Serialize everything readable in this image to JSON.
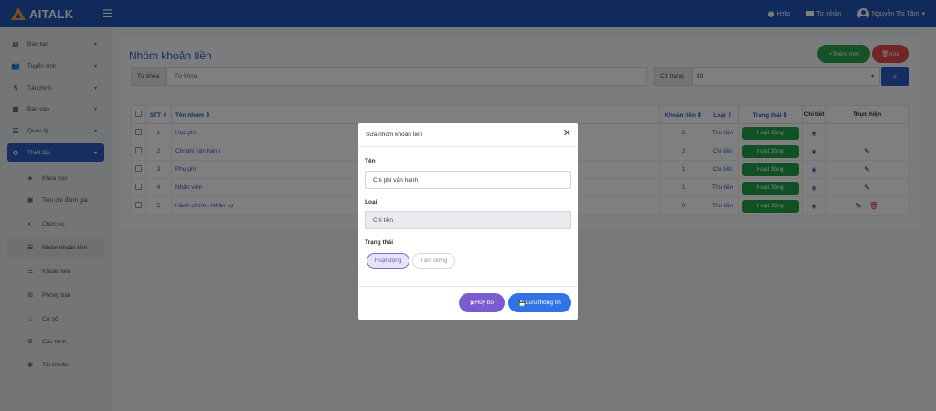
{
  "app": {
    "logo_text": "AITALK"
  },
  "topbar": {
    "help_label": "Help",
    "messages_label": "Tin nhắn",
    "user_name": "Nguyễn Thị Tâm"
  },
  "sidebar": {
    "items": [
      {
        "label": "Đào tạo",
        "icon": "book-icon"
      },
      {
        "label": "Tuyển sinh",
        "icon": "users-icon"
      },
      {
        "label": "Tài chính",
        "icon": "dollar-icon"
      },
      {
        "label": "Báo cáo",
        "icon": "report-icon"
      },
      {
        "label": "Quản lý",
        "icon": "list-icon"
      },
      {
        "label": "Thiết lập",
        "icon": "cogs-icon"
      }
    ],
    "sub_items": [
      {
        "label": "Khóa học",
        "icon": "layers-icon"
      },
      {
        "label": "Tiêu chí đánh giá",
        "icon": "criteria-icon"
      },
      {
        "label": "Chức vụ",
        "icon": "shield-icon"
      },
      {
        "label": "Nhóm khoản tiền",
        "icon": "list-icon"
      },
      {
        "label": "Khoản tiền",
        "icon": "list-icon"
      },
      {
        "label": "Phòng ban",
        "icon": "sitemap-icon"
      },
      {
        "label": "Cơ sở",
        "icon": "building-icon"
      },
      {
        "label": "Cấu hình",
        "icon": "gear-icon"
      },
      {
        "label": "Tài khoản",
        "icon": "account-icon"
      }
    ]
  },
  "main": {
    "title": "Nhóm khoản tiền",
    "add_label": "+Thêm mới",
    "delete_label": "Xóa",
    "keyword_label": "Từ khóa",
    "keyword_placeholder": "Từ khóa",
    "page_size_label": "Cỡ trang",
    "page_size_value": "20"
  },
  "table": {
    "headers": [
      "STT",
      "Tên nhóm",
      "Khoản tiền",
      "Loại",
      "Trạng thái",
      "Chi tiết",
      "Thực hiện"
    ],
    "rows": [
      {
        "stt": "1",
        "name": "Học phí",
        "count": "2",
        "type": "Thu tiền",
        "status": "Hoạt động"
      },
      {
        "stt": "2",
        "name": "Chi phí vận hành",
        "count": "2",
        "type": "Chi tiền",
        "status": "Hoạt động"
      },
      {
        "stt": "3",
        "name": "Phụ phí",
        "count": "1",
        "type": "Chi tiền",
        "status": "Hoạt động"
      },
      {
        "stt": "4",
        "name": "Nhân viên",
        "count": "1",
        "type": "Thu tiền",
        "status": "Hoạt động"
      },
      {
        "stt": "5",
        "name": "Hành chính - Nhân sự",
        "count": "0",
        "type": "Thu tiền",
        "status": "Hoạt động"
      }
    ]
  },
  "modal": {
    "title": "Sửa nhóm khoản tiền",
    "name_label": "Tên",
    "name_value": "Chi phí vận hành",
    "type_label": "Loại",
    "type_value": "Chi tiền",
    "status_label": "Trạng thái",
    "status_active": "Hoạt động",
    "status_paused": "Tạm dừng",
    "cancel_label": "Hủy bỏ",
    "save_label": "Lưu thông tin"
  }
}
